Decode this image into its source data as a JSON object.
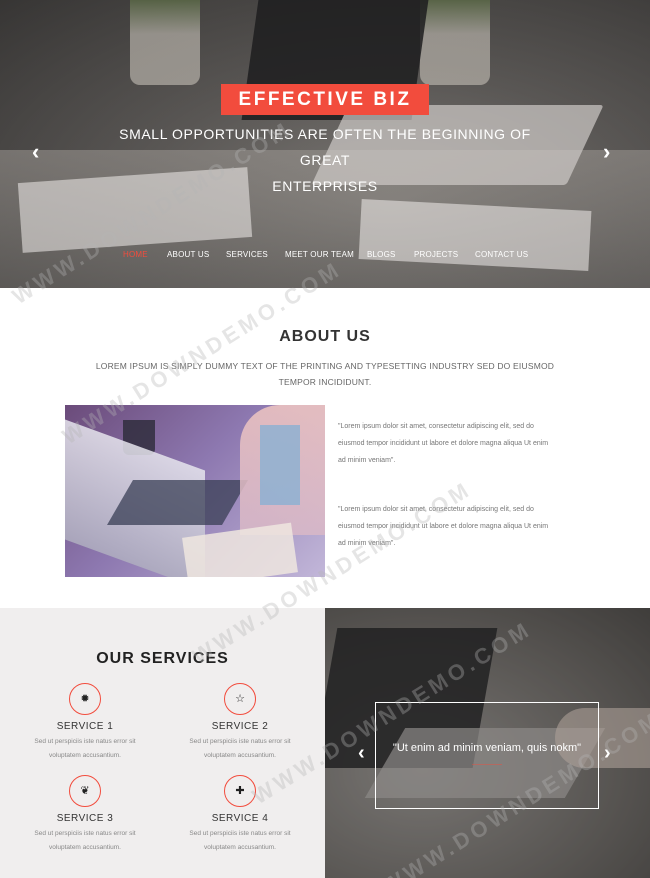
{
  "hero": {
    "title": "EFFECTIVE BIZ",
    "subtitle_line1": "SMALL OPPORTUNITIES ARE OFTEN THE BEGINNING OF GREAT",
    "subtitle_line2": "ENTERPRISES",
    "prev_arrow": "‹",
    "next_arrow": "›"
  },
  "nav": {
    "items": [
      "HOME",
      "ABOUT US",
      "SERVICES",
      "MEET OUR TEAM",
      "BLOGS",
      "PROJECTS",
      "CONTACT US"
    ],
    "active": "HOME",
    "accent_color": "#f24c3d"
  },
  "about": {
    "title": "ABOUT US",
    "lead": "LOREM IPSUM IS SIMPLY DUMMY TEXT OF THE PRINTING AND TYPESETTING INDUSTRY SED DO EIUSMOD TEMPOR INCIDIDUNT.",
    "quote1_line1": "\"Lorem ipsum dolor sit amet, consectetur adipiscing elit, sed do",
    "quote1_line2": "eiusmod tempor incididunt ut labore et dolore magna aliqua Ut enim",
    "quote1_line3": "ad minim veniam\".",
    "quote2_line1": "\"Lorem ipsum dolor sit amet, consectetur adipiscing elit, sed do",
    "quote2_line2": "eiusmod tempor incididunt ut labore et dolore magna aliqua Ut enim",
    "quote2_line3": "ad minim veniam\"."
  },
  "services": {
    "title": "OUR SERVICES",
    "items": [
      {
        "name": "SERVICE 1",
        "icon": "gear-icon",
        "glyph": "✹",
        "desc1": "Sed ut perspiciis iste natus error sit",
        "desc2": "voluptatem accusantium."
      },
      {
        "name": "SERVICE 2",
        "icon": "star-icon",
        "glyph": "☆",
        "desc1": "Sed ut perspiciis iste natus error sit",
        "desc2": "voluptatem accusantium."
      },
      {
        "name": "SERVICE 3",
        "icon": "leaf-icon",
        "glyph": "❦",
        "desc1": "Sed ut perspiciis iste natus error sit",
        "desc2": "voluptatem accusantium."
      },
      {
        "name": "SERVICE 4",
        "icon": "gift-icon",
        "glyph": "✚",
        "desc1": "Sed ut perspiciis iste natus error sit",
        "desc2": "voluptatem accusantium."
      }
    ]
  },
  "testimonial": {
    "quote": "\"Ut enim ad minim veniam, quis nokm\"",
    "author": "—————",
    "prev_arrow": "‹",
    "next_arrow": "›"
  },
  "watermark": "WWW.DOWNDEMO.COM"
}
